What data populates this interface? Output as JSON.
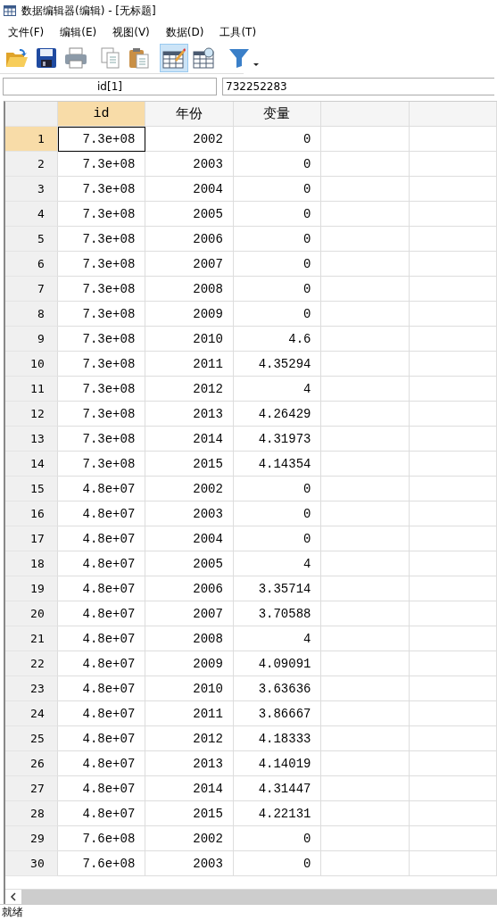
{
  "window": {
    "title": "数据编辑器(编辑) - [无标题]"
  },
  "menu": [
    "文件(F)",
    "编辑(E)",
    "视图(V)",
    "数据(D)",
    "工具(T)"
  ],
  "toolbar": [
    {
      "kind": "open",
      "on": false
    },
    {
      "kind": "save",
      "on": false
    },
    {
      "kind": "print",
      "on": false
    },
    {
      "kind": "copy",
      "on": false
    },
    {
      "kind": "paste",
      "on": false
    },
    {
      "kind": "edit",
      "on": true
    },
    {
      "kind": "browse",
      "on": false
    },
    {
      "kind": "filter",
      "on": false
    }
  ],
  "cell_name": "id[1]",
  "cell_value": "732252283",
  "table": {
    "columns": [
      {
        "label": "id",
        "selected": true
      },
      {
        "label": "年份",
        "selected": false
      },
      {
        "label": "变量",
        "selected": false
      }
    ],
    "rows": [
      {
        "num": "1",
        "cells": [
          "7.3e+08",
          "2002",
          "0"
        ],
        "selected": true
      },
      {
        "num": "2",
        "cells": [
          "7.3e+08",
          "2003",
          "0"
        ],
        "selected": false
      },
      {
        "num": "3",
        "cells": [
          "7.3e+08",
          "2004",
          "0"
        ],
        "selected": false
      },
      {
        "num": "4",
        "cells": [
          "7.3e+08",
          "2005",
          "0"
        ],
        "selected": false
      },
      {
        "num": "5",
        "cells": [
          "7.3e+08",
          "2006",
          "0"
        ],
        "selected": false
      },
      {
        "num": "6",
        "cells": [
          "7.3e+08",
          "2007",
          "0"
        ],
        "selected": false
      },
      {
        "num": "7",
        "cells": [
          "7.3e+08",
          "2008",
          "0"
        ],
        "selected": false
      },
      {
        "num": "8",
        "cells": [
          "7.3e+08",
          "2009",
          "0"
        ],
        "selected": false
      },
      {
        "num": "9",
        "cells": [
          "7.3e+08",
          "2010",
          "4.6"
        ],
        "selected": false
      },
      {
        "num": "10",
        "cells": [
          "7.3e+08",
          "2011",
          "4.35294"
        ],
        "selected": false
      },
      {
        "num": "11",
        "cells": [
          "7.3e+08",
          "2012",
          "4"
        ],
        "selected": false
      },
      {
        "num": "12",
        "cells": [
          "7.3e+08",
          "2013",
          "4.26429"
        ],
        "selected": false
      },
      {
        "num": "13",
        "cells": [
          "7.3e+08",
          "2014",
          "4.31973"
        ],
        "selected": false
      },
      {
        "num": "14",
        "cells": [
          "7.3e+08",
          "2015",
          "4.14354"
        ],
        "selected": false
      },
      {
        "num": "15",
        "cells": [
          "4.8e+07",
          "2002",
          "0"
        ],
        "selected": false
      },
      {
        "num": "16",
        "cells": [
          "4.8e+07",
          "2003",
          "0"
        ],
        "selected": false
      },
      {
        "num": "17",
        "cells": [
          "4.8e+07",
          "2004",
          "0"
        ],
        "selected": false
      },
      {
        "num": "18",
        "cells": [
          "4.8e+07",
          "2005",
          "4"
        ],
        "selected": false
      },
      {
        "num": "19",
        "cells": [
          "4.8e+07",
          "2006",
          "3.35714"
        ],
        "selected": false
      },
      {
        "num": "20",
        "cells": [
          "4.8e+07",
          "2007",
          "3.70588"
        ],
        "selected": false
      },
      {
        "num": "21",
        "cells": [
          "4.8e+07",
          "2008",
          "4"
        ],
        "selected": false
      },
      {
        "num": "22",
        "cells": [
          "4.8e+07",
          "2009",
          "4.09091"
        ],
        "selected": false
      },
      {
        "num": "23",
        "cells": [
          "4.8e+07",
          "2010",
          "3.63636"
        ],
        "selected": false
      },
      {
        "num": "24",
        "cells": [
          "4.8e+07",
          "2011",
          "3.86667"
        ],
        "selected": false
      },
      {
        "num": "25",
        "cells": [
          "4.8e+07",
          "2012",
          "4.18333"
        ],
        "selected": false
      },
      {
        "num": "26",
        "cells": [
          "4.8e+07",
          "2013",
          "4.14019"
        ],
        "selected": false
      },
      {
        "num": "27",
        "cells": [
          "4.8e+07",
          "2014",
          "4.31447"
        ],
        "selected": false
      },
      {
        "num": "28",
        "cells": [
          "4.8e+07",
          "2015",
          "4.22131"
        ],
        "selected": false
      },
      {
        "num": "29",
        "cells": [
          "7.6e+08",
          "2002",
          "0"
        ],
        "selected": false
      },
      {
        "num": "30",
        "cells": [
          "7.6e+08",
          "2003",
          "0"
        ],
        "selected": false
      }
    ]
  },
  "status_bar": "就绪"
}
